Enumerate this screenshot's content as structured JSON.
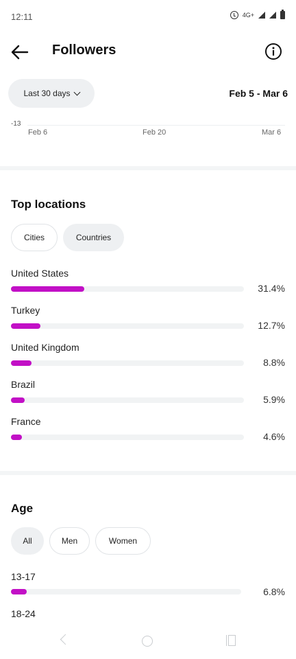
{
  "status_bar": {
    "time": "12:11",
    "network": "4G+"
  },
  "header": {
    "title": "Followers",
    "back_icon": "arrow-left-icon",
    "info_icon": "info-circle-icon"
  },
  "date_filter": {
    "range_label": "Last 30 days",
    "date_range": "Feb 5 - Mar 6"
  },
  "chart": {
    "y_tick": "-13",
    "x_ticks": [
      "Feb 6",
      "Feb 20",
      "Mar 6"
    ]
  },
  "top_locations": {
    "title": "Top locations",
    "tabs": [
      "Cities",
      "Countries"
    ],
    "items": [
      {
        "label": "United States",
        "percent": "31.4%",
        "value": 31.4
      },
      {
        "label": "Turkey",
        "percent": "12.7%",
        "value": 12.7
      },
      {
        "label": "United Kingdom",
        "percent": "8.8%",
        "value": 8.8
      },
      {
        "label": "Brazil",
        "percent": "5.9%",
        "value": 5.9
      },
      {
        "label": "France",
        "percent": "4.6%",
        "value": 4.6
      }
    ]
  },
  "age": {
    "title": "Age",
    "tabs": [
      "All",
      "Men",
      "Women"
    ],
    "items": [
      {
        "label": "13-17",
        "percent": "6.8%",
        "value": 6.8
      },
      {
        "label": "18-24",
        "percent": "",
        "value": null
      }
    ]
  },
  "colors": {
    "accent": "#c210c6",
    "track": "#f1f3f4",
    "pill_bg": "#eef0f2"
  }
}
